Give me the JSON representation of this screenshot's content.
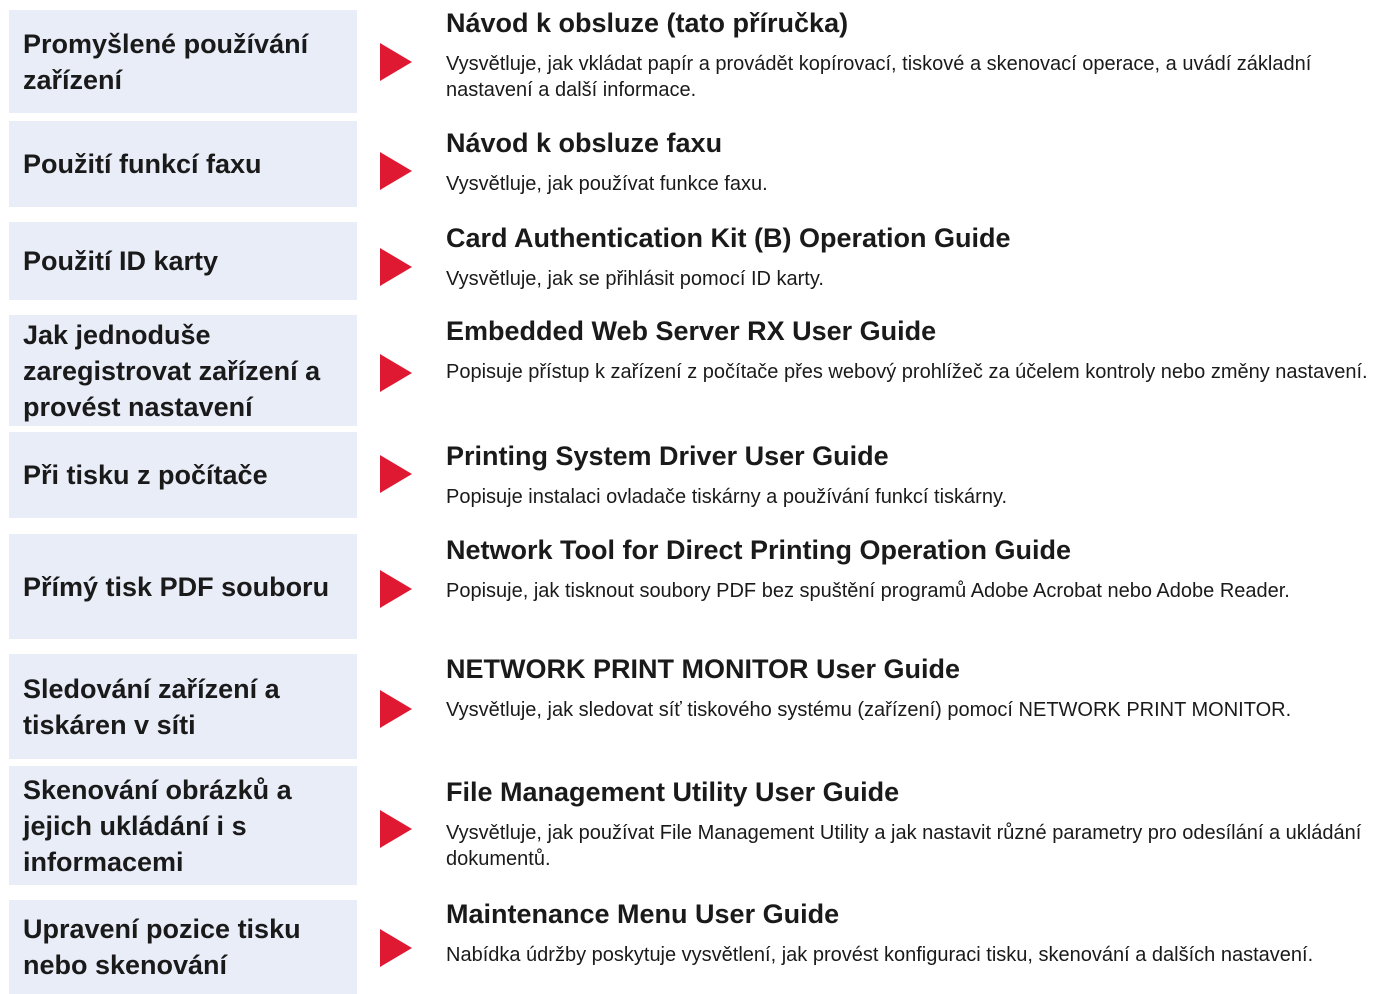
{
  "items": [
    {
      "purpose": "Promyšlené používání zařízení",
      "guide_title": "Návod k obsluze (tato příručka)",
      "description": "Vysvětluje, jak vkládat papír a provádět kopírovací, tiskové a skenovací operace, a uvádí základní nastavení a další informace."
    },
    {
      "purpose": "Použití funkcí faxu",
      "guide_title": "Návod k obsluze faxu",
      "description": "Vysvětluje, jak používat funkce faxu."
    },
    {
      "purpose": "Použití ID karty",
      "guide_title": "Card Authentication Kit (B) Operation Guide",
      "description": "Vysvětluje, jak se přihlásit pomocí ID karty."
    },
    {
      "purpose": "Jak jednoduše zaregistrovat zařízení a provést nastavení",
      "guide_title": "Embedded Web Server RX User Guide",
      "description": "Popisuje přístup k zařízení z počítače přes webový prohlížeč za účelem kontroly nebo změny nastavení."
    },
    {
      "purpose": "Při tisku z počítače",
      "guide_title": "Printing System Driver User Guide",
      "description": "Popisuje instalaci ovladače tiskárny a používání funkcí tiskárny."
    },
    {
      "purpose": "Přímý tisk PDF souboru",
      "guide_title": "Network Tool for Direct Printing Operation Guide",
      "description": "Popisuje, jak tisknout soubory PDF bez spuštění programů Adobe Acrobat nebo Adobe Reader."
    },
    {
      "purpose": "Sledování zařízení a tiskáren v síti",
      "guide_title": "NETWORK PRINT MONITOR User Guide",
      "description": "Vysvětluje, jak sledovat síť tiskového systému (zařízení) pomocí NETWORK PRINT MONITOR."
    },
    {
      "purpose": "Skenování obrázků a jejich ukládání i s informacemi",
      "guide_title": "File Management Utility User Guide",
      "description": "Vysvětluje, jak používat File Management Utility a jak nastavit různé parametry pro odesílání a ukládání dokumentů."
    },
    {
      "purpose": "Upravení pozice tisku nebo skenování",
      "guide_title": "Maintenance Menu User Guide",
      "description": "Nabídka údržby poskytuje vysvětlení, jak provést konfiguraci tisku, skenování a dalších nastavení."
    }
  ]
}
